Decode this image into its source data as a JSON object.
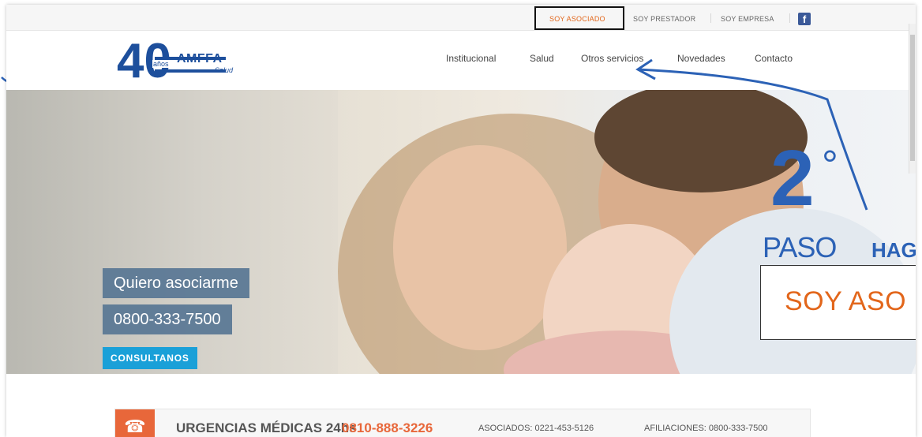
{
  "topbar": {
    "links": [
      "SOY ASOCIADO",
      "SOY PRESTADOR",
      "SOY EMPRESA"
    ],
    "facebook_icon": "facebook-icon"
  },
  "logo": {
    "number": "40",
    "anos": "años",
    "brand": "AMFFA",
    "sub": "Salud"
  },
  "nav": [
    "Institucional",
    "Salud",
    "Otros servicios",
    "Novedades",
    "Contacto"
  ],
  "hero": {
    "cta_join": "Quiero asociarme",
    "cta_phone": "0800-333-7500",
    "cta_contact": "CONSULTANOS"
  },
  "annotation": {
    "step_number": "2",
    "step_degree": "°",
    "step_word": "PASO",
    "instruction": "HAGA",
    "callout_text": "SOY ASO",
    "accent_color": "#2c62b6",
    "callout_color": "#e2661b"
  },
  "urgencias": {
    "title": "URGENCIAS MÉDICAS 24hs",
    "phone": "0810-888-3226",
    "asociados": "ASOCIADOS: 0221-453-5126",
    "afiliaciones": "AFILIACIONES: 0800-333-7500",
    "icon": "phone-icon"
  }
}
